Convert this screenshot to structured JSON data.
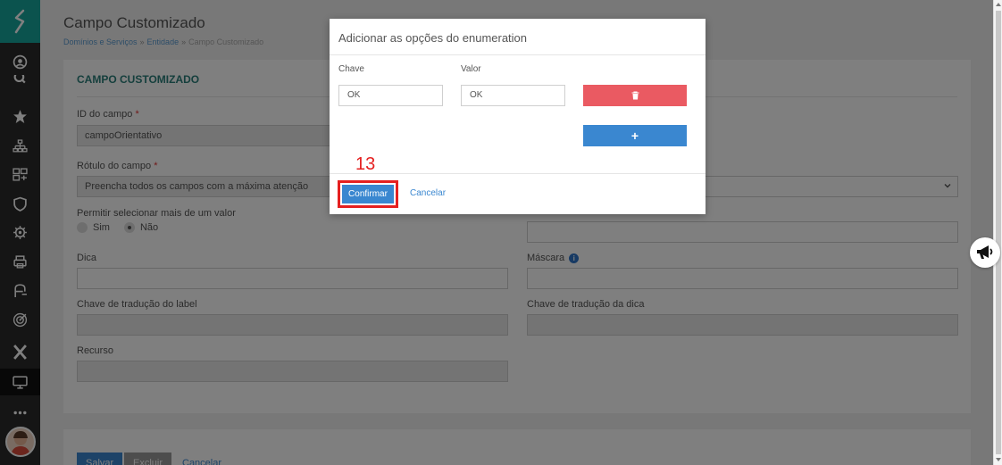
{
  "page": {
    "title": "Campo Customizado",
    "breadcrumb": [
      "Domínios e Serviços",
      "Entidade",
      "Campo Customizado"
    ]
  },
  "form": {
    "section_title": "CAMPO CUSTOMIZADO",
    "id_label": "ID do campo",
    "id_value": "campoOrientativo",
    "rotulo_label": "Rótulo do campo",
    "rotulo_value": "Preencha todos os campos com a máxima atenção",
    "multi_label": "Permitir selecionar mais de um valor",
    "radio_sim": "Sim",
    "radio_nao": "Não",
    "radio_selected": "Não",
    "dica_label": "Dica",
    "mascara_label": "Máscara",
    "traducao_label_label": "Chave de tradução do label",
    "traducao_dica_label": "Chave de tradução da dica",
    "recurso_label": "Recurso",
    "required_mark": "*",
    "info_mark": "i"
  },
  "footer": {
    "save": "Salvar",
    "delete": "Excluir",
    "cancel": "Cancelar"
  },
  "modal": {
    "title": "Adicionar as opções do enumeration",
    "chave_label": "Chave",
    "valor_label": "Valor",
    "chave_value": "OK",
    "valor_value": "OK",
    "delete_icon": "trash-icon",
    "add_symbol": "+",
    "step_number": "13",
    "confirm": "Confirmar",
    "cancel": "Cancelar"
  },
  "colors": {
    "brand": "#17a79d",
    "primary": "#3a87d0",
    "danger": "#ea5a62",
    "highlight": "#e52020"
  }
}
